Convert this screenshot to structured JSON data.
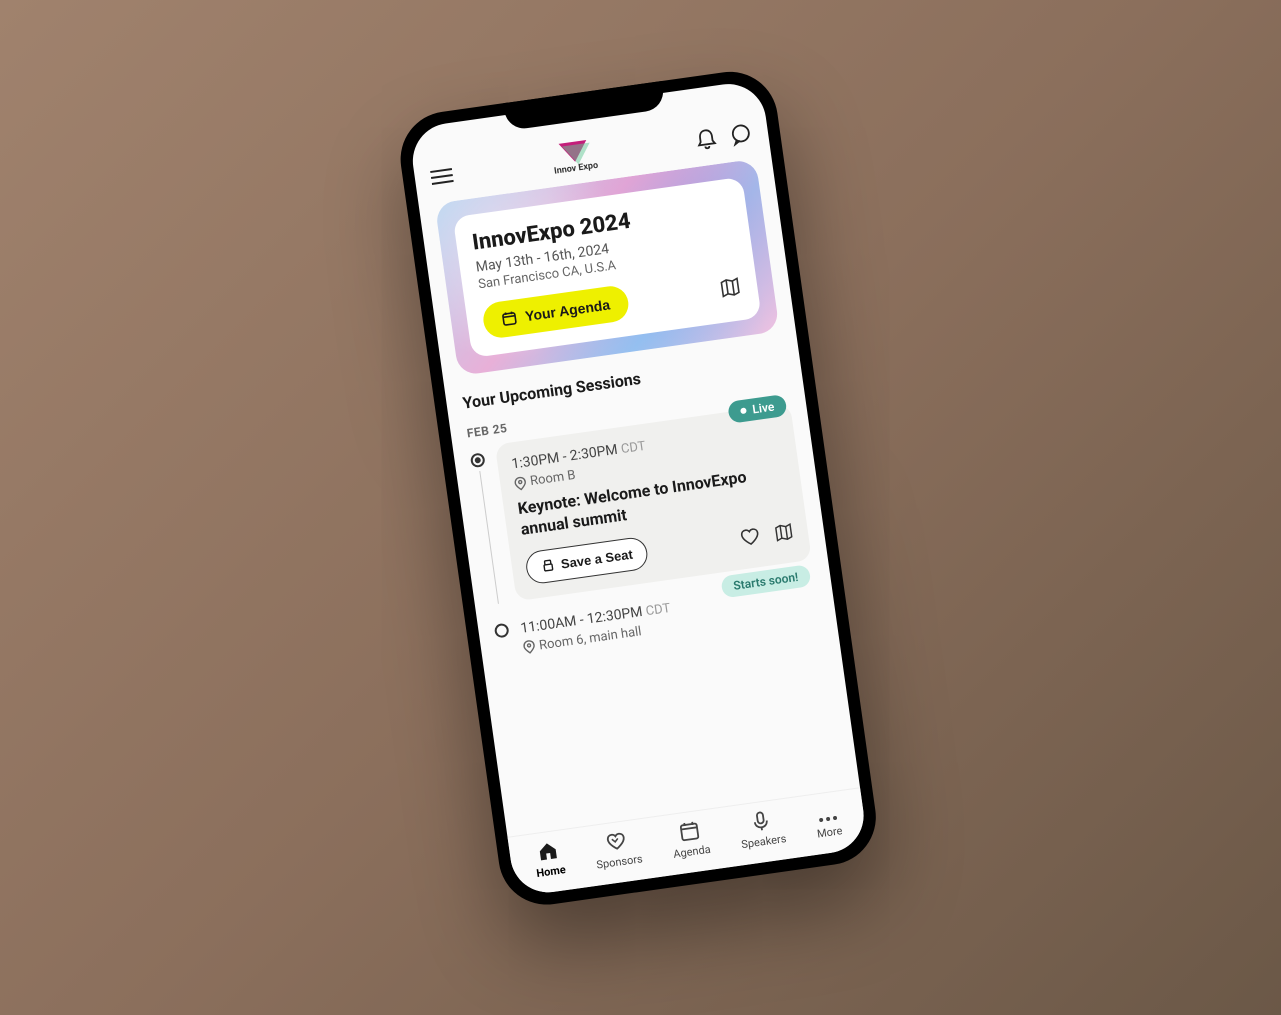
{
  "header": {
    "logo_text": "Innov Expo"
  },
  "hero": {
    "title": "InnovExpo 2024",
    "dates": "May 13th - 16th, 2024",
    "location": "San Francisco CA, U.S.A",
    "agenda_button": "Your Agenda"
  },
  "sessions": {
    "section_title": "Your Upcoming Sessions",
    "date_label": "FEB 25",
    "items": [
      {
        "badge": "Live",
        "time_range": "1:30PM - 2:30PM",
        "timezone": "CDT",
        "room": "Room B",
        "title": "Keynote: Welcome to InnovExpo annual summit",
        "seat_button": "Save a Seat"
      },
      {
        "badge": "Starts soon!",
        "time_range": "11:00AM - 12:30PM",
        "timezone": "CDT",
        "room": "Room 6, main hall"
      }
    ]
  },
  "nav": {
    "items": [
      {
        "label": "Home"
      },
      {
        "label": "Sponsors"
      },
      {
        "label": "Agenda"
      },
      {
        "label": "Speakers"
      },
      {
        "label": "More"
      }
    ]
  }
}
